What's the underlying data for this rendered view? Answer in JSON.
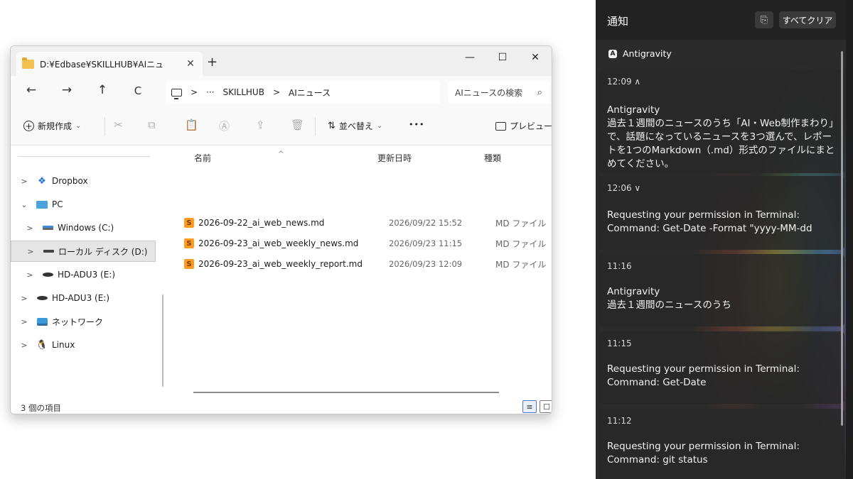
{
  "explorer": {
    "tab_title": "D:¥Edbase¥SKILLHUB¥AIニュ",
    "tab_close": "✕",
    "tab_add": "+",
    "window": {
      "minimize": "—",
      "maximize": "☐",
      "close": "✕"
    },
    "nav": {
      "back": "←",
      "forward": "→",
      "up": "↑",
      "refresh": "C"
    },
    "address": {
      "sep1": ">",
      "ellipsis": "···",
      "crumb1": "SKILLHUB",
      "sep2": ">",
      "crumb2": "AIニュース"
    },
    "search_text": "AIニュースの検索",
    "search_glyph": "⌕",
    "toolbar": {
      "new_label": "新規作成",
      "sort_label": "並べ替え",
      "more": "•••",
      "preview_label": "プレビュー"
    },
    "sidebar": [
      {
        "label": "Dropbox",
        "chevron": ">",
        "icon": "dropbox-icon"
      },
      {
        "label": "PC",
        "chevron": "⌄",
        "icon": "monitor-icon"
      },
      {
        "label": "Windows (C:)",
        "chevron": ">",
        "icon": "windows-drive-icon"
      },
      {
        "label": "ローカル ディスク (D:)",
        "chevron": ">",
        "icon": "local-disk-icon",
        "selected": true
      },
      {
        "label": "HD-ADU3 (E:)",
        "chevron": ">",
        "icon": "external-drive-icon"
      },
      {
        "label": "HD-ADU3 (E:)",
        "chevron": ">",
        "icon": "external-drive-icon"
      },
      {
        "label": "ネットワーク",
        "chevron": ">",
        "icon": "network-icon"
      },
      {
        "label": "Linux",
        "chevron": ">",
        "icon": "linux-icon"
      }
    ],
    "columns": {
      "name": "名前",
      "date": "更新日時",
      "type": "種類"
    },
    "files": [
      {
        "name": "2026-09-22_ai_web_news.md",
        "date": "2026/09/22 15:52",
        "type": "MD ファイル"
      },
      {
        "name": "2026-09-23_ai_web_weekly_news.md",
        "date": "2026/09/23 11:15",
        "type": "MD ファイル"
      },
      {
        "name": "2026-09-23_ai_web_weekly_report.md",
        "date": "2026/09/23 12:09",
        "type": "MD ファイル"
      }
    ],
    "status": "3 個の項目"
  },
  "notifications": {
    "title": "通知",
    "clear_all": "すべてクリア",
    "app_name": "Antigravity",
    "items": [
      {
        "time": "12:09 ∧",
        "title": "Antigravity",
        "body": "過去１週間のニュースのうち「AI・Web制作まわり」で、話題になっているニュースを3つ選んで、レポートを1つのMarkdown（.md）形式のファイルにまとめてください。"
      },
      {
        "time": "12:06 ∨",
        "title": "Requesting your permission in Terminal:",
        "body": "Command: Get-Date -Format \"yyyy-MM-dd"
      },
      {
        "time": "11:16",
        "title": "Antigravity",
        "body": "過去１週間のニュースのうち"
      },
      {
        "time": "11:15",
        "title": "Requesting your permission in Terminal:",
        "body": "Command: Get-Date"
      },
      {
        "time": "11:12",
        "title": "Requesting your permission in Terminal:",
        "body": "Command: git status"
      }
    ]
  }
}
